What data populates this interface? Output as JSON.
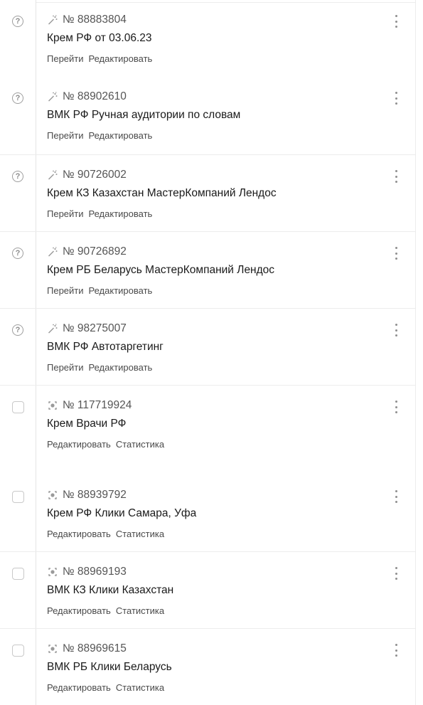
{
  "rows": [
    {
      "status": "help",
      "id": "№ 88883804",
      "title": "Крем РФ от 03.06.23",
      "links": [
        "Перейти",
        "Редактировать"
      ]
    },
    {
      "status": "help",
      "id": "№ 88902610",
      "title": "ВМК РФ Ручная аудитории по словам",
      "links": [
        "Перейти",
        "Редактировать"
      ]
    },
    {
      "status": "help",
      "id": "№ 90726002",
      "title": "Крем КЗ Казахстан МастерКомпаний Лендос",
      "links": [
        "Перейти",
        "Редактировать"
      ]
    },
    {
      "status": "help",
      "id": "№ 90726892",
      "title": "Крем РБ Беларусь МастерКомпаний Лендос",
      "links": [
        "Перейти",
        "Редактировать"
      ]
    },
    {
      "status": "help",
      "id": "№ 98275007",
      "title": "ВМК РФ Автотаргетинг",
      "links": [
        "Перейти",
        "Редактировать"
      ]
    },
    {
      "status": "checkbox",
      "id": "№ 117719924",
      "title": "Крем Врачи РФ",
      "links": [
        "Редактировать",
        "Статистика"
      ]
    },
    {
      "status": "checkbox",
      "id": "№ 88939792",
      "title": "Крем РФ Клики Самара, Уфа",
      "links": [
        "Редактировать",
        "Статистика"
      ]
    },
    {
      "status": "checkbox",
      "id": "№ 88969193",
      "title": "ВМК КЗ Клики Казахстан",
      "links": [
        "Редактировать",
        "Статистика"
      ]
    },
    {
      "status": "checkbox",
      "id": "№ 88969615",
      "title": "ВМК РБ Клики Беларусь",
      "links": [
        "Редактировать",
        "Статистика"
      ]
    }
  ],
  "icons": {
    "help": "question-circle-icon",
    "checkbox": "checkbox",
    "strategy_manual": "strategy-wand-icon",
    "strategy_auto": "strategy-target-icon",
    "menu": "more-vertical-icon"
  }
}
